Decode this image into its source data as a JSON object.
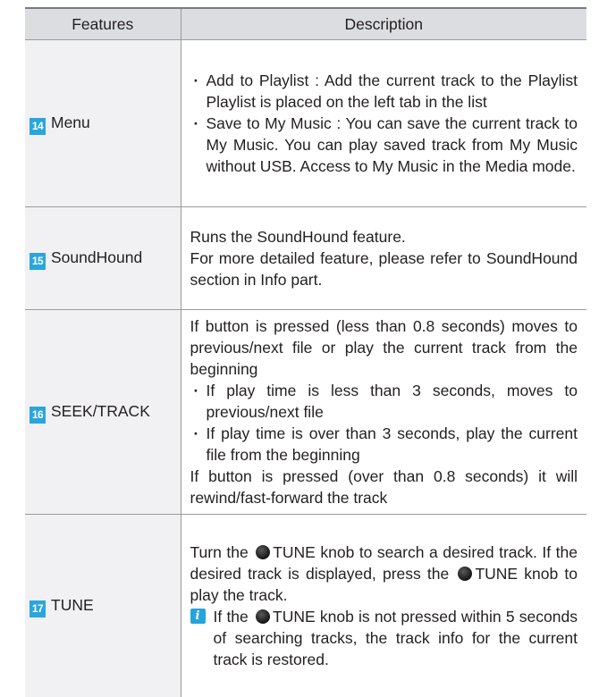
{
  "headers": {
    "features": "Features",
    "description": "Description"
  },
  "rows": [
    {
      "num": "14",
      "feature": "Menu",
      "bullets": [
        "Add to Playlist : Add the current track to the Playlist Playlist is placed on the left tab in the list",
        "Save to My Music : You can save the current track to My Music. You can play saved track from My Music without USB.  Access to My Music in the Media mode."
      ]
    },
    {
      "num": "15",
      "feature": "SoundHound",
      "lines": [
        "Runs the SoundHound feature.",
        "For more detailed feature, please refer to SoundHound section in Info part."
      ]
    },
    {
      "num": "16",
      "feature": "SEEK/TRACK",
      "intro": "If button is pressed (less than 0.8 seconds) moves to previous/next file or play the current track from the beginning",
      "bullets": [
        "If play time is less than 3 seconds, moves to previous/next file",
        "If play time is over than 3 seconds, play the current file from the beginning"
      ],
      "outro": "If button is pressed (over than 0.8 seconds) it will rewind/fast-forward the track"
    },
    {
      "num": "17",
      "feature": "TUNE",
      "p1_a": "Turn the",
      "p1_b": "TUNE knob to search a desired track. If the desired track is displayed, press the",
      "p1_c": "TUNE knob to play the track.",
      "note_a": "If the",
      "note_b": "TUNE knob is not pressed within 5 seconds of searching tracks, the track info for the current track is restored."
    }
  ]
}
